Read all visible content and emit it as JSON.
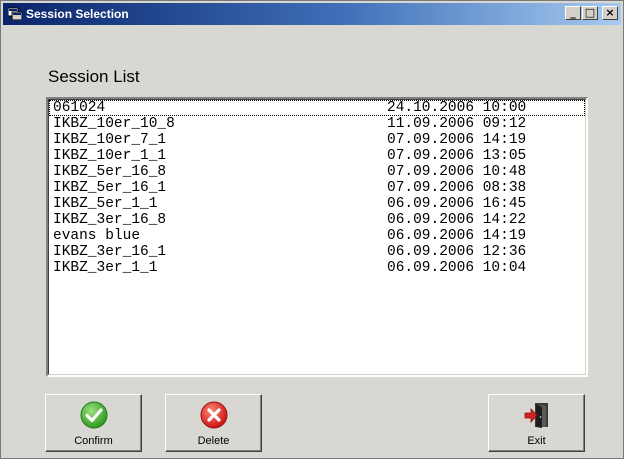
{
  "window": {
    "title": "Session Selection",
    "minimize_glyph": "_",
    "maximize_glyph": "□",
    "close_glyph": "×"
  },
  "section_label": "Session List",
  "sessions": [
    {
      "name": "061024",
      "date": "24.10.2006 10:00",
      "selected": true
    },
    {
      "name": "IKBZ_10er_10_8",
      "date": "11.09.2006 09:12"
    },
    {
      "name": "IKBZ_10er_7_1",
      "date": "07.09.2006 14:19"
    },
    {
      "name": "IKBZ_10er_1_1",
      "date": "07.09.2006 13:05"
    },
    {
      "name": "IKBZ_5er_16_8",
      "date": "07.09.2006 10:48"
    },
    {
      "name": "IKBZ_5er_16_1",
      "date": "07.09.2006 08:38"
    },
    {
      "name": "IKBZ_5er_1_1",
      "date": "06.09.2006 16:45"
    },
    {
      "name": "IKBZ_3er_16_8",
      "date": "06.09.2006 14:22"
    },
    {
      "name": "evans blue",
      "date": "06.09.2006 14:19"
    },
    {
      "name": "IKBZ_3er_16_1",
      "date": "06.09.2006 12:36"
    },
    {
      "name": "IKBZ_3er_1_1",
      "date": "06.09.2006 10:04"
    }
  ],
  "buttons": {
    "confirm_label": "Confirm",
    "delete_label": "Delete",
    "exit_label": "Exit"
  },
  "icons": {
    "confirm": "green-checkmark-icon",
    "delete": "red-x-icon",
    "exit": "exit-door-icon"
  },
  "colors": {
    "title_gradient_start": "#0a246a",
    "title_gradient_end": "#a6caf0",
    "confirm_green": "#3fae2a",
    "delete_red": "#e02020",
    "window_bg": "#d9d7d2"
  }
}
